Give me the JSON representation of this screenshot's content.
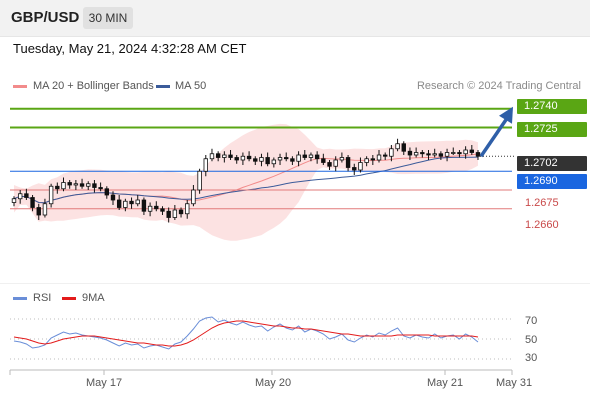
{
  "header": {
    "symbol": "GBP/USD",
    "timeframe": "30 MIN"
  },
  "timestamp": "Tuesday, May 21, 2024 4:32:28 AM CET",
  "legend": {
    "ma20": "MA 20 + Bollinger Bands",
    "ma50": "MA 50",
    "ma20_color": "#f28b8b",
    "ma50_color": "#3b5b9a"
  },
  "credit": "Research © 2024 Trading Central",
  "levels": {
    "r2": "1.2740",
    "r1": "1.2725",
    "last": "1.2702",
    "pivot": "1.2690",
    "s1": "1.2675",
    "s2": "1.2660",
    "resistance_color": "#5aa614",
    "pivot_color": "#1a66e0",
    "support_color": "#e27a7a",
    "last_color": "#333333"
  },
  "rsi_legend": {
    "rsi": "RSI",
    "ma9": "9MA",
    "rsi_color": "#6a8ed8",
    "ma9_color": "#e31b1b"
  },
  "chart_data": [
    {
      "type": "candlestick",
      "title": "GBP/USD 30 MIN",
      "ylim": [
        1.2627,
        1.2751
      ],
      "price_axis_labels": [
        "1.2740",
        "1.2725",
        "1.2702",
        "1.2690",
        "1.2675",
        "1.2660"
      ],
      "x_labels": [
        "May 17",
        "May 20",
        "May 21",
        "May 31"
      ],
      "lines": {
        "resistance_2": 1.274,
        "resistance_1": 1.2725,
        "last_price": 1.2702,
        "pivot": 1.269,
        "support_1": 1.2675,
        "support_2": 1.266
      },
      "forecast_arrow": {
        "from": 1.2702,
        "to": 1.274
      },
      "series": [
        {
          "name": "Close",
          "values": [
            1.2668,
            1.2672,
            1.2669,
            1.2661,
            1.2655,
            1.2664,
            1.2678,
            1.2676,
            1.2681,
            1.2679,
            1.268,
            1.2678,
            1.268,
            1.2677,
            1.2676,
            1.2671,
            1.2667,
            1.2661,
            1.2666,
            1.2664,
            1.2667,
            1.2658,
            1.2662,
            1.266,
            1.2658,
            1.2653,
            1.2659,
            1.2656,
            1.2664,
            1.2675,
            1.269,
            1.27,
            1.2704,
            1.2701,
            1.2703,
            1.2701,
            1.2699,
            1.2702,
            1.27,
            1.2698,
            1.2701,
            1.2696,
            1.2699,
            1.2701,
            1.27,
            1.2698,
            1.2703,
            1.2701,
            1.2703,
            1.27,
            1.2697,
            1.2694,
            1.2699,
            1.2701,
            1.2693,
            1.2691,
            1.2697,
            1.27,
            1.2699,
            1.2703,
            1.2702,
            1.2708,
            1.2712,
            1.2706,
            1.2703,
            1.2705,
            1.2704,
            1.2703,
            1.2704,
            1.2702,
            1.2705,
            1.2705,
            1.2704,
            1.2707,
            1.2705,
            1.2702
          ]
        }
      ]
    },
    {
      "type": "line",
      "title": "RSI",
      "ylim": [
        25,
        75
      ],
      "y_ticks": [
        30,
        50,
        70
      ],
      "series": [
        {
          "name": "RSI",
          "values": [
            48,
            47,
            45,
            41,
            42,
            44,
            51,
            54,
            57,
            55,
            56,
            54,
            53,
            52,
            51,
            49,
            46,
            43,
            46,
            44,
            45,
            41,
            43,
            44,
            42,
            40,
            45,
            47,
            53,
            60,
            68,
            71,
            72,
            67,
            69,
            66,
            64,
            67,
            64,
            62,
            63,
            58,
            62,
            65,
            61,
            59,
            63,
            57,
            60,
            58,
            55,
            50,
            52,
            55,
            49,
            47,
            51,
            54,
            52,
            56,
            54,
            58,
            61,
            53,
            51,
            54,
            52,
            51,
            55,
            51,
            53,
            54,
            50,
            55,
            52,
            47
          ]
        },
        {
          "name": "9MA",
          "values": [
            52,
            51,
            50,
            48,
            46,
            45,
            46,
            48,
            50,
            51,
            52,
            53,
            53,
            53,
            52,
            51,
            50,
            49,
            48,
            47,
            46,
            46,
            45,
            44,
            44,
            43,
            43,
            44,
            46,
            49,
            53,
            57,
            61,
            64,
            66,
            67,
            68,
            68,
            67,
            66,
            65,
            64,
            63,
            63,
            62,
            61,
            61,
            60,
            60,
            59,
            58,
            57,
            56,
            55,
            55,
            54,
            53,
            53,
            53,
            53,
            53,
            53,
            54,
            54,
            54,
            54,
            54,
            54,
            53,
            53,
            53,
            53,
            53,
            53,
            53,
            52
          ]
        }
      ]
    }
  ]
}
